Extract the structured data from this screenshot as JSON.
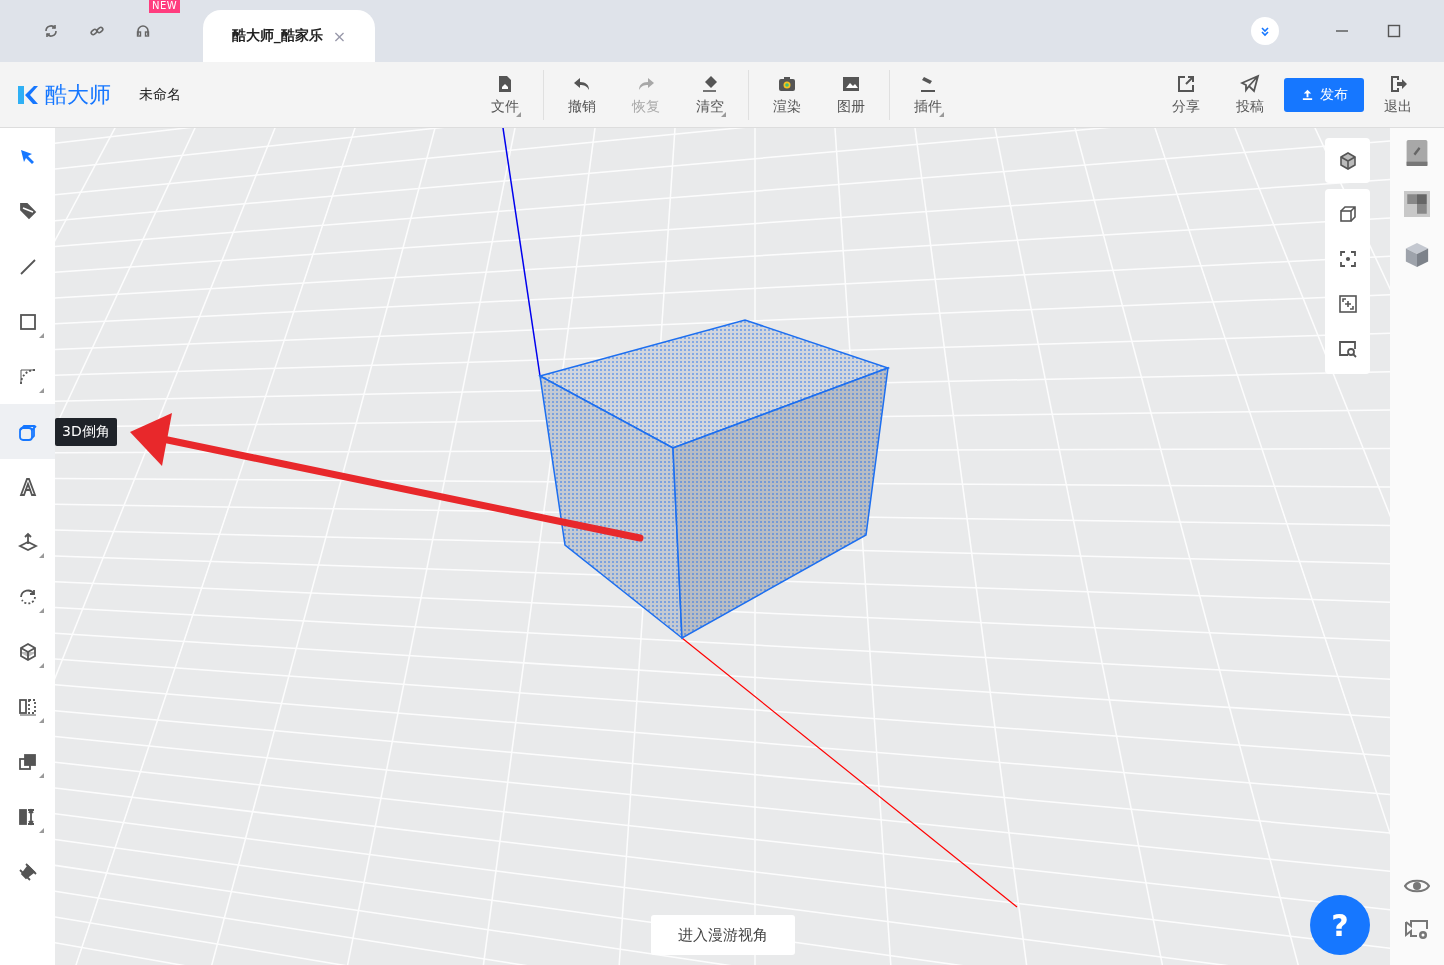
{
  "titlebar": {
    "new_badge": "NEW",
    "tab": {
      "title": "酷大师_酷家乐",
      "close": "×",
      "selected": true
    }
  },
  "toolbar": {
    "logo": "酷大师",
    "file_name": "未命名",
    "items": [
      {
        "label": "文件",
        "has_menu": true,
        "disabled": false
      },
      {
        "label": "撤销",
        "has_menu": false,
        "disabled": false
      },
      {
        "label": "恢复",
        "has_menu": false,
        "disabled": true
      },
      {
        "label": "清空",
        "has_menu": true,
        "disabled": false
      },
      {
        "label": "渲染",
        "has_menu": false,
        "disabled": false
      },
      {
        "label": "图册",
        "has_menu": false,
        "disabled": false
      },
      {
        "label": "插件",
        "has_menu": true,
        "disabled": false
      }
    ],
    "right_items": [
      {
        "label": "分享",
        "kind": "tool"
      },
      {
        "label": "投稿",
        "kind": "tool"
      },
      {
        "label": "发布",
        "kind": "primary"
      },
      {
        "label": "退出",
        "kind": "tool"
      }
    ]
  },
  "tools": [
    {
      "selected": true,
      "highlighted": false,
      "has_menu": false
    },
    {
      "selected": false,
      "highlighted": false,
      "has_menu": false
    },
    {
      "selected": false,
      "highlighted": false,
      "has_menu": false
    },
    {
      "selected": false,
      "highlighted": false,
      "has_menu": true
    },
    {
      "selected": false,
      "highlighted": false,
      "has_menu": true
    },
    {
      "selected": true,
      "highlighted": true,
      "has_menu": false,
      "tooltip": "3D倒角"
    },
    {
      "selected": false,
      "highlighted": false,
      "has_menu": false
    },
    {
      "selected": false,
      "highlighted": false,
      "has_menu": true
    },
    {
      "selected": false,
      "highlighted": false,
      "has_menu": true
    },
    {
      "selected": false,
      "highlighted": false,
      "has_menu": true
    },
    {
      "selected": false,
      "highlighted": false,
      "has_menu": true
    },
    {
      "selected": false,
      "highlighted": false,
      "has_menu": true
    },
    {
      "selected": false,
      "highlighted": false,
      "has_menu": true
    },
    {
      "selected": false,
      "highlighted": false,
      "has_menu": false
    }
  ],
  "canvas": {
    "roam_button": "进入漫游视角",
    "help": "?"
  }
}
